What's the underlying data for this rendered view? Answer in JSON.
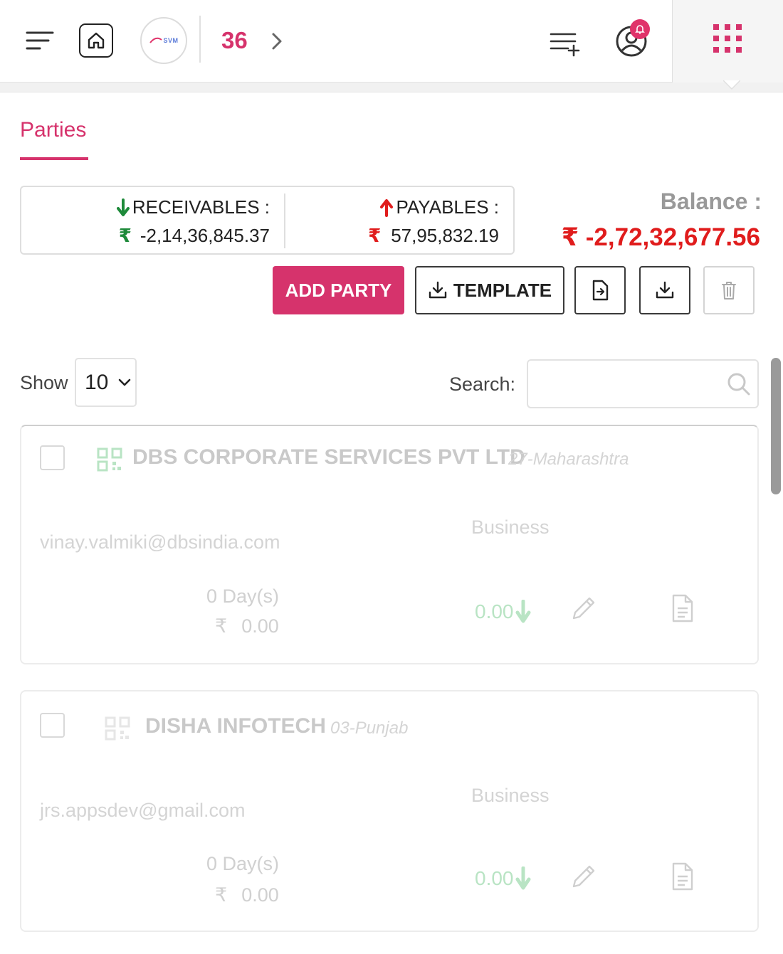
{
  "header": {
    "logo_text": "SVM",
    "counter": "36",
    "notification_count": "",
    "colors": {
      "accent": "#d6336c",
      "negative": "#e01c1c",
      "positive": "#1e8a3a"
    }
  },
  "tabs": [
    {
      "label": "Parties",
      "active": true
    }
  ],
  "summary": {
    "receivables_label": "RECEIVABLES :",
    "receivables_value": "-2,14,36,845.37",
    "payables_label": "PAYABLES :",
    "payables_value": "57,95,832.19",
    "currency_symbol": "₹",
    "balance_label": "Balance :",
    "balance_value": "₹ -2,72,32,677.56"
  },
  "actions": {
    "add_party": "ADD PARTY",
    "template": "TEMPLATE"
  },
  "table_controls": {
    "show_label": "Show",
    "page_size": "10",
    "search_label": "Search:",
    "search_value": "",
    "search_placeholder": ""
  },
  "parties": [
    {
      "name": "DBS CORPORATE SERVICES PVT LTD",
      "state": "27-Maharashtra",
      "type": "Business",
      "email": "vinay.valmiki@dbsindia.com",
      "days": "0 Day(s)",
      "amount": "0.00",
      "balance": "0.00",
      "currency_symbol": "₹"
    },
    {
      "name": "DISHA INFOTECH",
      "state": "03-Punjab",
      "type": "Business",
      "email": "jrs.appsdev@gmail.com",
      "days": "0 Day(s)",
      "amount": "0.00",
      "balance": "0.00",
      "currency_symbol": "₹"
    }
  ]
}
